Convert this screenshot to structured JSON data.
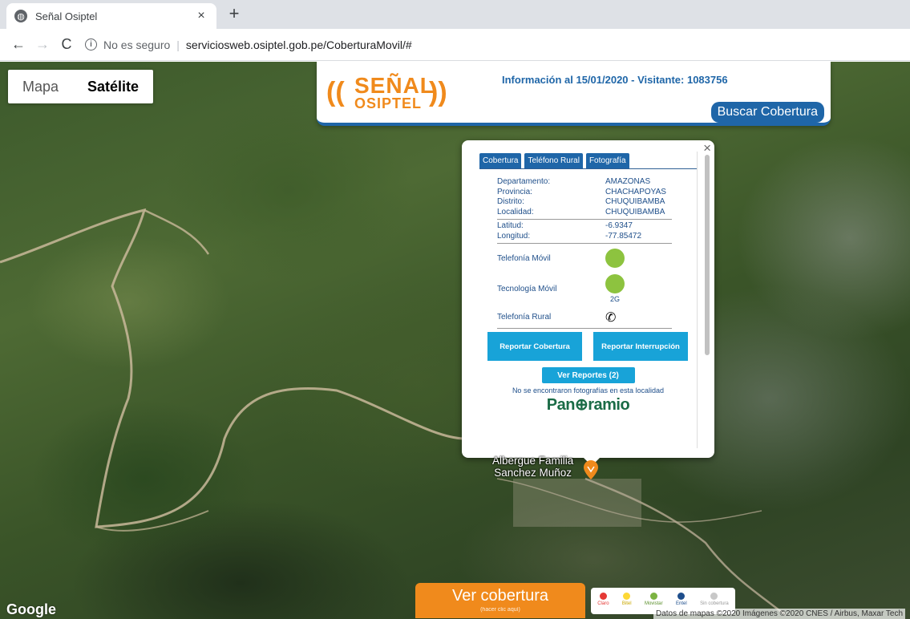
{
  "browser": {
    "tab_title": "Señal Osiptel",
    "tab_close": "×",
    "new_tab": "+",
    "insecure_label": "No es seguro",
    "separator": "|",
    "url": "serviciosweb.osiptel.gob.pe/CoberturaMovil/#"
  },
  "map_type": {
    "map_label": "Mapa",
    "satellite_label": "Satélite",
    "active": "Satélite"
  },
  "banner": {
    "logo_line1": "SEÑAL",
    "logo_line2": "OSIPTEL",
    "info": "Información al 15/01/2020 - Visitante: 1083756",
    "search_button": "Buscar Cobertura",
    "accent_color": "#1f66a8",
    "brand_color": "#f08a1c"
  },
  "info_window": {
    "close": "×",
    "tabs": [
      "Cobertura",
      "Teléfono Rural",
      "Fotografía"
    ],
    "location": [
      {
        "label": "Departamento:",
        "value": "AMAZONAS"
      },
      {
        "label": "Provincia:",
        "value": "CHACHAPOYAS"
      },
      {
        "label": "Distrito:",
        "value": "CHUQUIBAMBA"
      },
      {
        "label": "Localidad:",
        "value": "CHUQUIBAMBA"
      }
    ],
    "coords": [
      {
        "label": "Latitud:",
        "value": "-6.9347"
      },
      {
        "label": "Longitud:",
        "value": "-77.85472"
      }
    ],
    "telefonia_movil_label": "Telefonía Móvil",
    "tecnologia_movil_label": "Tecnología Móvil",
    "tecnologia_value": "2G",
    "telefonia_rural_label": "Telefonía Rural",
    "status_color": "#8dc33f",
    "report_coverage": "Reportar Cobertura",
    "report_interruption": "Reportar Interrupción",
    "view_reports": "Ver Reportes (2)",
    "no_photos": "No se encontraron fotografías en esta localidad",
    "panoramio": "Pan⊕ramio"
  },
  "place": {
    "line1": "Albergue Familia",
    "line2": "Sanchez Muñoz"
  },
  "google_logo": "Google",
  "ver_cobertura": {
    "title": "Ver cobertura",
    "subtitle": "(hacer clic aquí)"
  },
  "legend": [
    {
      "label": "Claro",
      "color": "#e53935"
    },
    {
      "label": "Bitel",
      "color": "#fdd835"
    },
    {
      "label": "Movistar",
      "color": "#7cb342"
    },
    {
      "label": "Entel",
      "color": "#1e4e8c"
    },
    {
      "label": "Sin cobertura",
      "color": "#c8c8c8"
    }
  ],
  "attribution": "Datos de mapas ©2020 Imágenes ©2020 CNES / Airbus, Maxar Tech"
}
